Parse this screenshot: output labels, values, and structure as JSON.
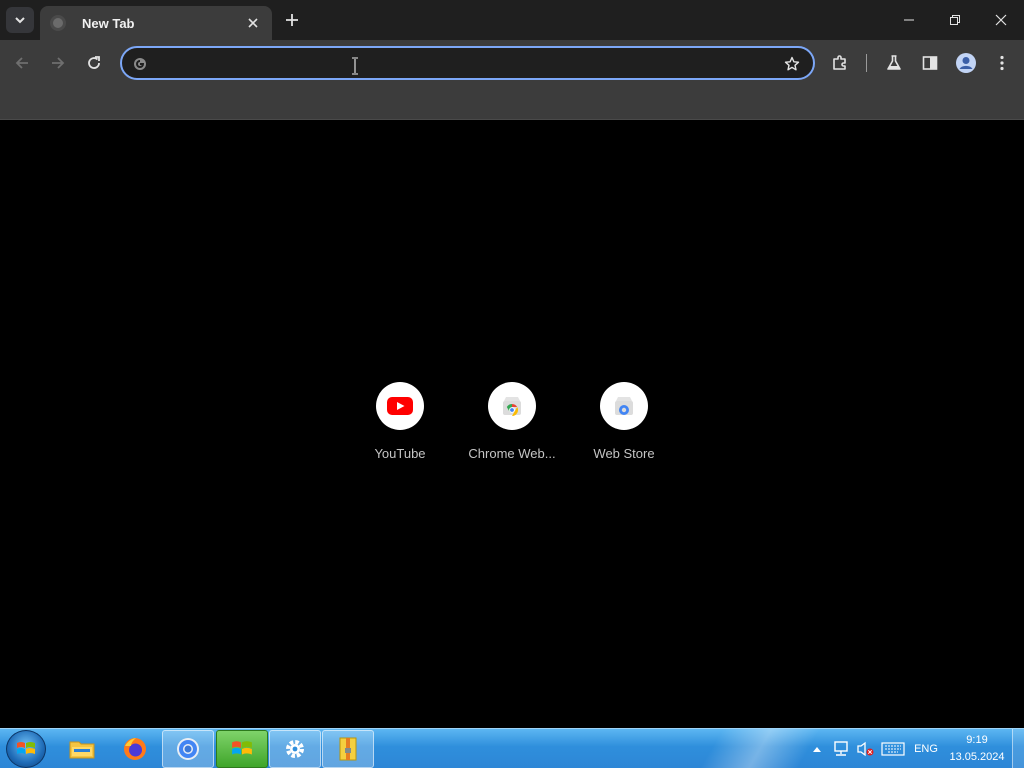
{
  "browser": {
    "tab": {
      "title": "New Tab"
    },
    "omnibox": {
      "value": "",
      "placeholder": ""
    },
    "accent_color": "#7ca7f7",
    "icons": {
      "tab_search": "chevron-down-icon",
      "new_tab": "plus-icon",
      "back": "arrow-left-icon",
      "forward": "arrow-right-icon",
      "reload": "reload-icon",
      "bookmark": "star-icon",
      "extensions": "puzzle-icon",
      "labs": "flask-icon",
      "side_panel": "side-panel-icon",
      "profile": "profile-icon",
      "menu": "kebab-menu-icon"
    }
  },
  "new_tab_page": {
    "shortcuts": [
      {
        "label": "YouTube",
        "icon": "youtube-icon"
      },
      {
        "label": "Chrome Web...",
        "icon": "chrome-web-store-icon"
      },
      {
        "label": "Web Store",
        "icon": "web-store-icon"
      }
    ]
  },
  "taskbar": {
    "apps": [
      "file-explorer-icon",
      "firefox-icon",
      "chrome-icon",
      "windows-app-icon",
      "settings-icon",
      "archive-icon"
    ],
    "tray": {
      "language": "ENG"
    },
    "clock": {
      "time": "9:19",
      "date": "13.05.2024"
    }
  }
}
